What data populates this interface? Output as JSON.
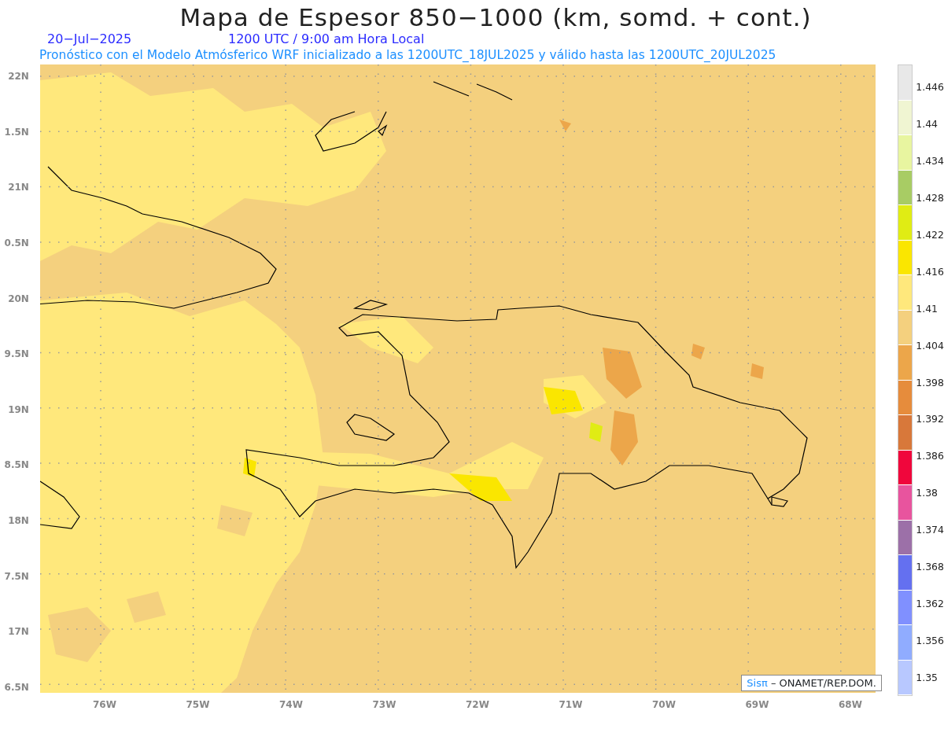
{
  "title": "Mapa de Espesor 850−1000 (km, somd. + cont.)",
  "date": "20−Jul−2025",
  "valid_time": "1200 UTC / 9:00 am Hora Local",
  "subtitle": "Pronóstico con el Modelo Atmósferico WRF inicializado a las 1200UTC_18JUL2025 y válido hasta las  1200UTC_20JUL2025",
  "y_ticks": [
    "22N",
    "1.5N",
    "21N",
    "0.5N",
    "20N",
    "9.5N",
    "19N",
    "8.5N",
    "18N",
    "7.5N",
    "17N",
    "6.5N"
  ],
  "x_ticks": [
    "76W",
    "75W",
    "74W",
    "73W",
    "72W",
    "71W",
    "70W",
    "69W",
    "68W"
  ],
  "legend": {
    "bins": [
      {
        "color": "#e8e8e8"
      },
      {
        "color": "#f0f5d2"
      },
      {
        "color": "#e8f5a0"
      },
      {
        "color": "#a8cc64"
      },
      {
        "color": "#e0ec14"
      },
      {
        "color": "#fae600"
      },
      {
        "color": "#ffe87c"
      },
      {
        "color": "#f4d07e"
      },
      {
        "color": "#eca64a"
      },
      {
        "color": "#e68c3c"
      },
      {
        "color": "#d8783a"
      },
      {
        "color": "#f0063c"
      },
      {
        "color": "#e8549e"
      },
      {
        "color": "#9c70a8"
      },
      {
        "color": "#6470f0"
      },
      {
        "color": "#8090ff"
      },
      {
        "color": "#90acff"
      },
      {
        "color": "#b8c8ff"
      }
    ],
    "labels": [
      "1.446",
      "1.44",
      "1.434",
      "1.428",
      "1.422",
      "1.416",
      "1.41",
      "1.404",
      "1.398",
      "1.392",
      "1.386",
      "1.38",
      "1.374",
      "1.368",
      "1.362",
      "1.356",
      "1.35"
    ]
  },
  "credits": {
    "logo": "Sisπ",
    "text": "– ONAMET/REP.DOM."
  }
}
